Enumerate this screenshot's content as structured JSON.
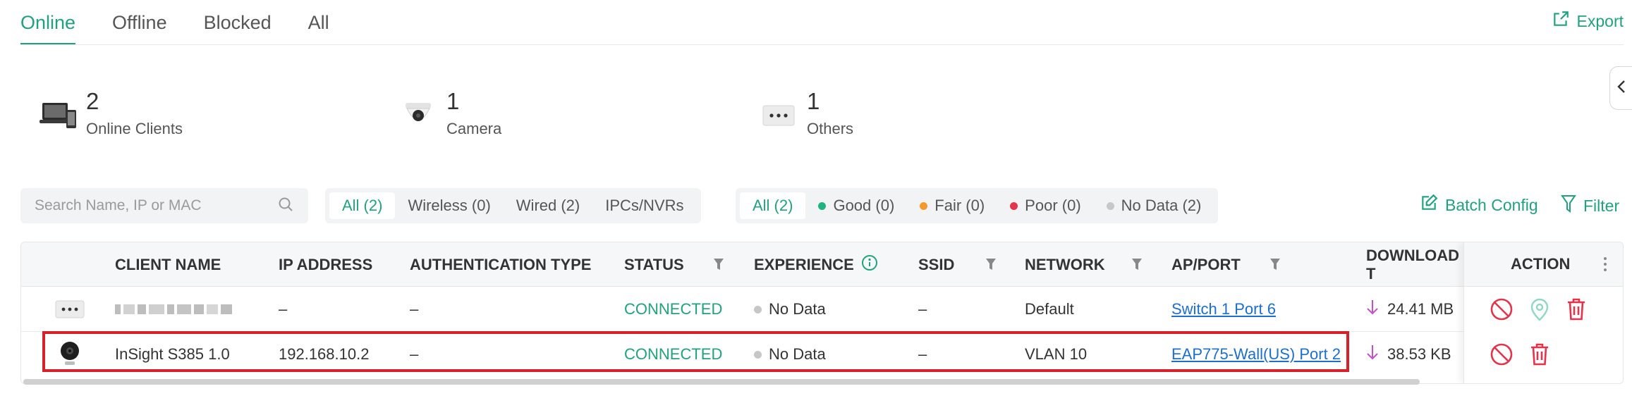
{
  "tabs": [
    "Online",
    "Offline",
    "Blocked",
    "All"
  ],
  "export_label": "Export",
  "summary": [
    {
      "count": "2",
      "label": "Online Clients",
      "icon": "devices-icon"
    },
    {
      "count": "1",
      "label": "Camera",
      "icon": "camera-icon"
    },
    {
      "count": "1",
      "label": "Others",
      "icon": "others-icon"
    }
  ],
  "search": {
    "placeholder": "Search Name, IP or MAC"
  },
  "connection_filters": [
    "All (2)",
    "Wireless (0)",
    "Wired (2)",
    "IPCs/NVRs"
  ],
  "experience_filters": [
    {
      "label": "All (2)",
      "color": ""
    },
    {
      "label": "Good (0)",
      "color": "#1fb37f"
    },
    {
      "label": "Fair (0)",
      "color": "#f39a2b"
    },
    {
      "label": "Poor (0)",
      "color": "#e5334b"
    },
    {
      "label": "No Data (2)",
      "color": "#c7c7c7"
    }
  ],
  "batch_config_label": "Batch Config",
  "filter_label": "Filter",
  "columns": {
    "client_name": "CLIENT NAME",
    "ip_address": "IP ADDRESS",
    "auth_type": "AUTHENTICATION TYPE",
    "status": "STATUS",
    "experience": "EXPERIENCE",
    "ssid": "SSID",
    "network": "NETWORK",
    "ap_port": "AP/PORT",
    "download": "DOWNLOAD T",
    "action": "ACTION"
  },
  "rows": [
    {
      "name": "",
      "ip": "–",
      "auth": "–",
      "status": "CONNECTED",
      "experience": "No Data",
      "ssid": "–",
      "network": "Default",
      "ap_port": "Switch 1 Port 6",
      "download": "24.41 MB"
    },
    {
      "name": "InSight S385 1.0",
      "ip": "192.168.10.2",
      "auth": "–",
      "status": "CONNECTED",
      "experience": "No Data",
      "ssid": "–",
      "network": "VLAN 10",
      "ap_port": "EAP775-Wall(US) Port 2",
      "download": "38.53 KB"
    }
  ],
  "colors": {
    "accent": "#1fa37f",
    "link": "#1a6fd1",
    "danger": "#e5334b",
    "highlight": "#d8202a"
  }
}
